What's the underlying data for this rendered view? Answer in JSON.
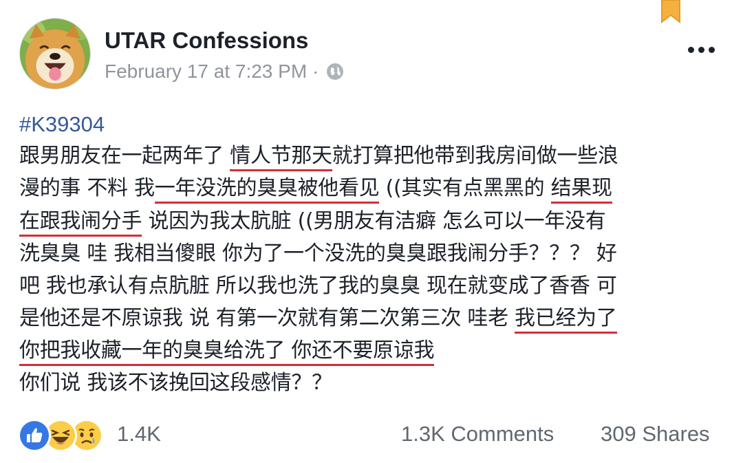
{
  "post": {
    "page_name": "UTAR Confessions",
    "timestamp": "February 17 at 7:23 PM",
    "separator": "·",
    "privacy_icon": "globe-icon",
    "hashtag": "#K39304"
  },
  "body_lines": [
    [
      {
        "t": "跟男朋友在一起两年了 "
      },
      {
        "t": "情人节那天",
        "hl": true
      },
      {
        "t": "就打算把他带到我房间做一些浪"
      }
    ],
    [
      {
        "t": "漫的事 不料 我"
      },
      {
        "t": "一年没洗的臭臭被他看见",
        "hl": true
      },
      {
        "t": " ((其实有点黑黑的 "
      },
      {
        "t": "结果现",
        "hl": true
      }
    ],
    [
      {
        "t": "在跟我闹分手",
        "hl": true
      },
      {
        "t": " 说因为我太肮脏 ((男朋友有洁癖 怎么可以一年没有"
      }
    ],
    [
      {
        "t": "洗臭臭 哇 我相当傻眼 你为了一个没洗的臭臭跟我闹分手？？？ 好"
      }
    ],
    [
      {
        "t": "吧 我也承认有点肮脏 所以我也洗了我的臭臭 现在就变成了香香 可"
      }
    ],
    [
      {
        "t": "是他还是不原谅我 说 有第一次就有第二次第三次 哇老 "
      },
      {
        "t": "我已经为了",
        "hl": true
      }
    ],
    [
      {
        "t": "你把我收藏一年的臭臭给洗了 你还不要原谅我",
        "hl": true
      }
    ],
    [
      {
        "t": "你们说 我该不该挽回这段感情？？"
      }
    ]
  ],
  "footer": {
    "reaction_icons": [
      "like-icon",
      "haha-icon",
      "sad-icon"
    ],
    "reaction_count": "1.4K",
    "comments": "1.3K Comments",
    "shares": "309 Shares"
  },
  "colors": {
    "text": "#1d2129",
    "meta": "#90949c",
    "hashtag": "#365899",
    "highlight_underline": "#d62c35",
    "like_blue": "#1877f2",
    "emoji_yellow": "#fcd34d",
    "bookmark": "#f5a623"
  }
}
